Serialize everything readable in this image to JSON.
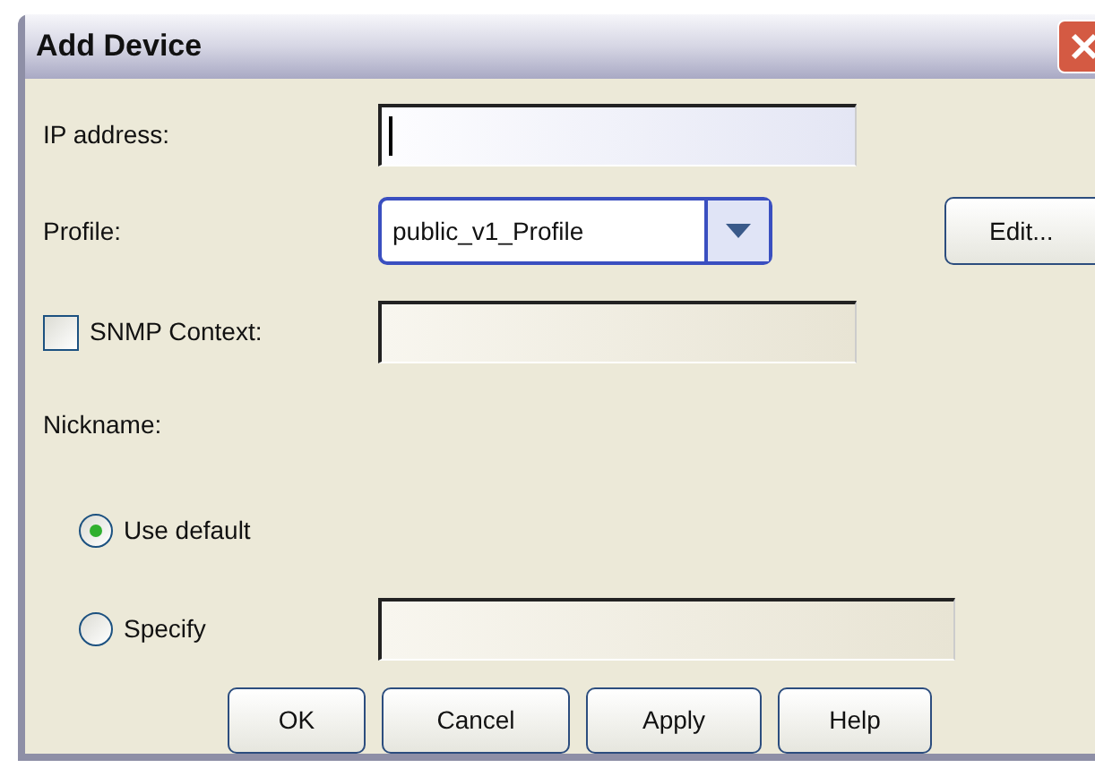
{
  "window": {
    "title": "Add Device"
  },
  "ip_address": {
    "label": "IP address:",
    "focused": true
  },
  "profile": {
    "label": "Profile:",
    "value": "public_v1_Profile",
    "edit_button": "Edit..."
  },
  "snmp_context": {
    "label": "SNMP Context:",
    "checked": false
  },
  "nickname": {
    "label": "Nickname:",
    "options": [
      {
        "label": "Use default",
        "selected": true
      },
      {
        "label": "Specify",
        "selected": false
      }
    ]
  },
  "buttons": [
    "OK",
    "Cancel",
    "Apply",
    "Help"
  ]
}
